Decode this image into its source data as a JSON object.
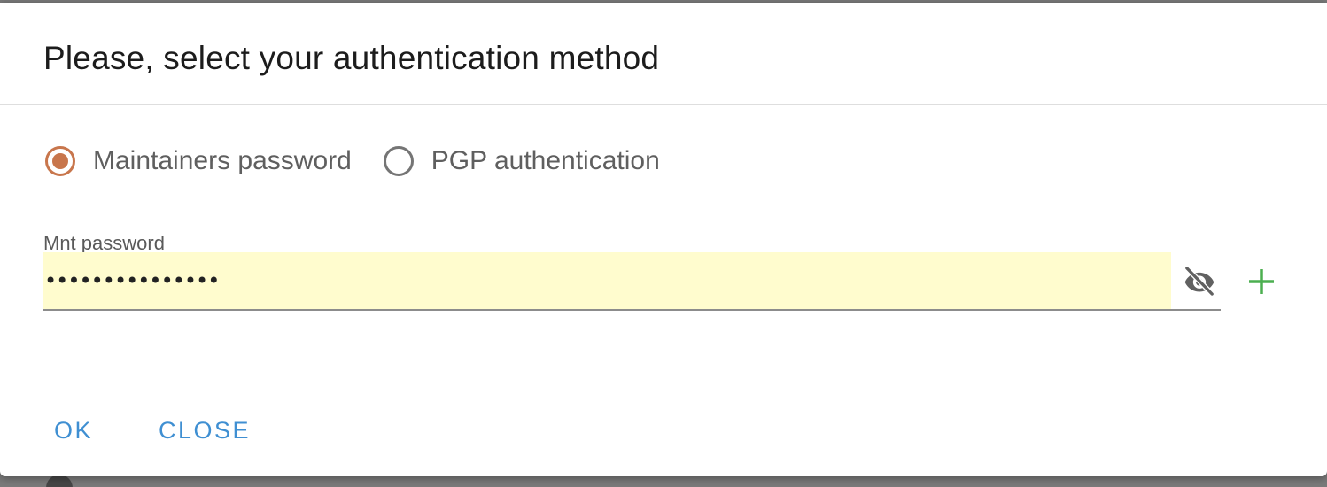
{
  "dialog": {
    "title": "Please, select your authentication method"
  },
  "auth_methods": {
    "options": [
      {
        "label": "Maintainers password",
        "selected": true
      },
      {
        "label": "PGP authentication",
        "selected": false
      }
    ]
  },
  "password_field": {
    "label": "Mnt password",
    "value": "•••••••••••••••",
    "background_color": "#fffcce",
    "visibility_icon": "eye-off-icon"
  },
  "add_action": {
    "icon": "plus-icon",
    "color": "#4caf50"
  },
  "footer": {
    "ok_label": "OK",
    "close_label": "CLOSE"
  },
  "colors": {
    "accent": "#c8764c",
    "button_text": "#3f8fd2"
  }
}
